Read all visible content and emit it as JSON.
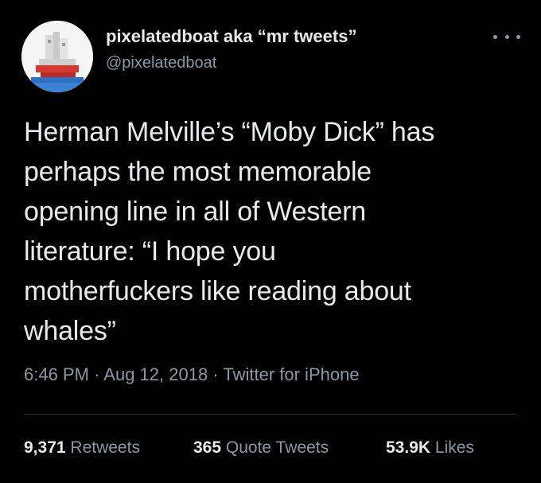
{
  "tweet": {
    "display_name": "pixelatedboat aka “mr tweets”",
    "handle": "@pixelatedboat",
    "more_icon": "more-horizontal-icon",
    "text": "Herman Melville’s “Moby Dick” has\nperhaps the most memorable\nopening line in all of Western\nliterature: “I hope you\nmotherfuckers like reading about\nwhales”",
    "time": "6:46 PM",
    "date": "Aug 12, 2018",
    "source": "Twitter for iPhone",
    "separator": "·",
    "stats": {
      "retweets_count": "9,371",
      "retweets_label": "Retweets",
      "quotes_count": "365",
      "quotes_label": "Quote Tweets",
      "likes_count": "53.9K",
      "likes_label": "Likes"
    }
  },
  "colors": {
    "background": "#000000",
    "primary_text": "#e7e9ea",
    "secondary_text": "#8b98a5",
    "divider": "#2f3336"
  }
}
